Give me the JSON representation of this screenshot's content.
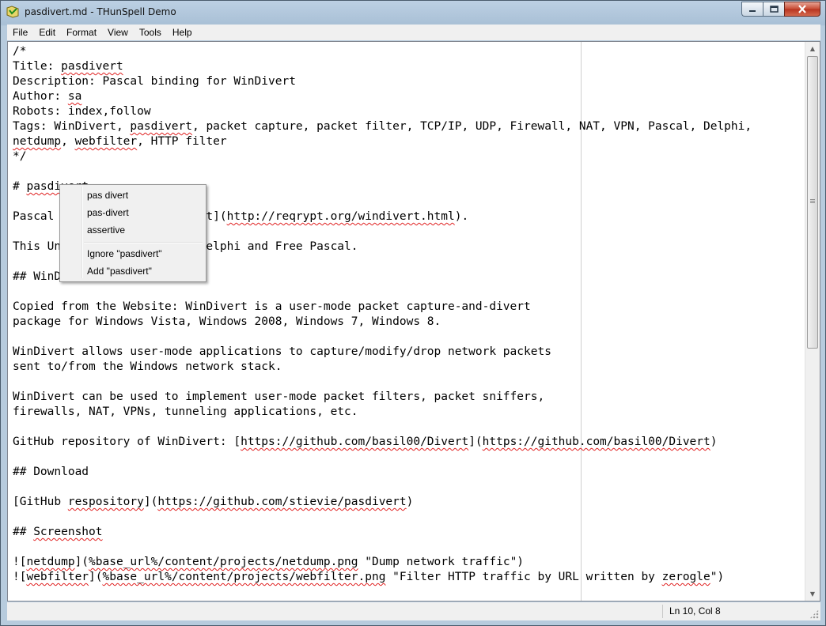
{
  "window": {
    "title": "pasdivert.md - THunSpell Demo"
  },
  "menubar": {
    "items": [
      "File",
      "Edit",
      "Format",
      "View",
      "Tools",
      "Help"
    ]
  },
  "editor": {
    "lines": [
      [
        {
          "t": "/*"
        }
      ],
      [
        {
          "t": "Title: "
        },
        {
          "t": "pasdivert",
          "err": true
        }
      ],
      [
        {
          "t": "Description: Pascal binding for WinDivert"
        }
      ],
      [
        {
          "t": "Author: "
        },
        {
          "t": "sa",
          "err": true
        }
      ],
      [
        {
          "t": "Robots: index,follow"
        }
      ],
      [
        {
          "t": "Tags: WinDivert, "
        },
        {
          "t": "pasdivert",
          "err": true
        },
        {
          "t": ", packet capture, packet filter, TCP/IP, UDP, Firewall, NAT, VPN, Pascal, Delphi,"
        }
      ],
      [
        {
          "t": "netdump",
          "err": true
        },
        {
          "t": ", "
        },
        {
          "t": "webfilter",
          "err": true
        },
        {
          "t": ", HTTP filter"
        }
      ],
      [
        {
          "t": "*/"
        }
      ],
      [
        {
          "t": ""
        }
      ],
      [
        {
          "t": "# "
        },
        {
          "t": "pasdivert",
          "err": true
        }
      ],
      [
        {
          "t": ""
        }
      ],
      [
        {
          "t": "Pascal binding for [WinDivert]("
        },
        {
          "t": "http://reqrypt.org/windivert.html",
          "err": true
        },
        {
          "t": ")."
        }
      ],
      [
        {
          "t": ""
        }
      ],
      [
        {
          "t": "This Unit can be used with Delphi and Free Pascal."
        }
      ],
      [
        {
          "t": ""
        }
      ],
      [
        {
          "t": "## WinDivert"
        }
      ],
      [
        {
          "t": ""
        }
      ],
      [
        {
          "t": "Copied from the Website: WinDivert is a user-mode packet capture-and-divert"
        }
      ],
      [
        {
          "t": "package for Windows Vista, Windows 2008, Windows 7, Windows 8."
        }
      ],
      [
        {
          "t": ""
        }
      ],
      [
        {
          "t": "WinDivert allows user-mode applications to capture/modify/drop network packets"
        }
      ],
      [
        {
          "t": "sent to/from the Windows network stack."
        }
      ],
      [
        {
          "t": ""
        }
      ],
      [
        {
          "t": "WinDivert can be used to implement user-mode packet filters, packet sniffers,"
        }
      ],
      [
        {
          "t": "firewalls, NAT, VPNs, tunneling applications, etc."
        }
      ],
      [
        {
          "t": ""
        }
      ],
      [
        {
          "t": "GitHub repository of WinDivert: ["
        },
        {
          "t": "https://github.com/basil00/Divert",
          "err": true
        },
        {
          "t": "]("
        },
        {
          "t": "https://github.com/basil00/Divert",
          "err": true
        },
        {
          "t": ")"
        }
      ],
      [
        {
          "t": ""
        }
      ],
      [
        {
          "t": "## Download"
        }
      ],
      [
        {
          "t": ""
        }
      ],
      [
        {
          "t": "[GitHub "
        },
        {
          "t": "respository",
          "err": true
        },
        {
          "t": "]("
        },
        {
          "t": "https://github.com/stievie/pasdivert",
          "err": true
        },
        {
          "t": ")"
        }
      ],
      [
        {
          "t": ""
        }
      ],
      [
        {
          "t": "## "
        },
        {
          "t": "Screenshot",
          "err": true
        }
      ],
      [
        {
          "t": ""
        }
      ],
      [
        {
          "t": "![",
          "err": false
        },
        {
          "t": "netdump",
          "err": true
        },
        {
          "t": "]("
        },
        {
          "t": "%base_url%/content/projects/netdump.png",
          "err": true
        },
        {
          "t": " \"Dump network traffic\")"
        }
      ],
      [
        {
          "t": "!["
        },
        {
          "t": "webfilter",
          "err": true
        },
        {
          "t": "]("
        },
        {
          "t": "%base_url%/content/projects/webfilter.png",
          "err": true
        },
        {
          "t": " \"Filter HTTP traffic by URL written by "
        },
        {
          "t": "zerogle",
          "err": true
        },
        {
          "t": "\")"
        }
      ]
    ]
  },
  "context_menu": {
    "suggestions": [
      "pas divert",
      "pas-divert",
      "assertive"
    ],
    "ignore_label": "Ignore \"pasdivert\"",
    "add_label": "Add \"pasdivert\""
  },
  "statusbar": {
    "position": "Ln 10, Col 8"
  },
  "colors": {
    "spell_error": "#e02020",
    "close_button": "#c74a33"
  }
}
